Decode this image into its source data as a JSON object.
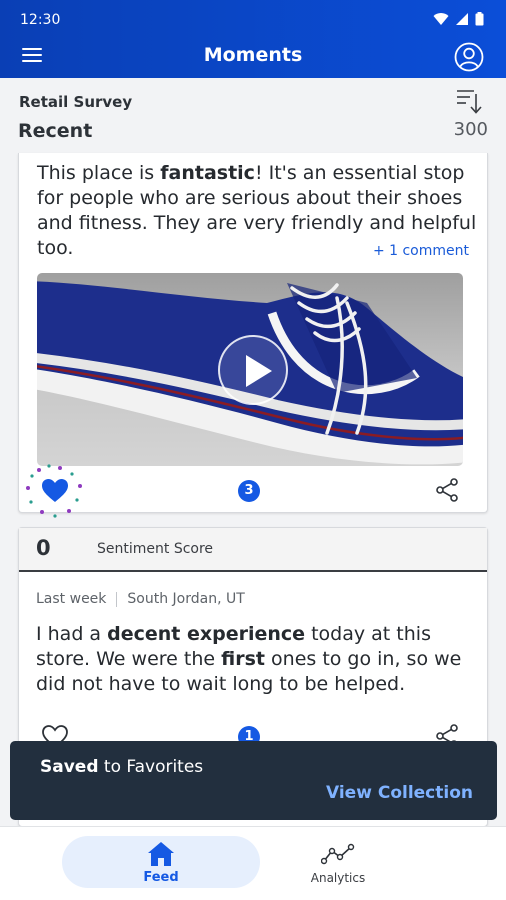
{
  "status_bar": {
    "time": "12:30"
  },
  "app_bar": {
    "title": "Moments"
  },
  "subheader": {
    "survey": "Retail Survey",
    "section": "Recent",
    "count": "300"
  },
  "card1": {
    "text_parts": [
      "This place is ",
      "fantastic",
      "! It's an essential stop for people who are serious about their shoes and fitness. They are very friendly and helpful too."
    ],
    "comment_link": "+ 1 comment",
    "badge_count": "3",
    "liked": true
  },
  "card2": {
    "score": "0",
    "score_label": "Sentiment Score",
    "time": "Last week",
    "location": "South Jordan, UT",
    "text_parts": [
      "I had a ",
      "decent experience",
      " today at this store. We were the ",
      "first",
      " ones to go in, so we did not have to wait long to be helped."
    ],
    "badge_count": "1",
    "liked": false
  },
  "snackbar": {
    "bold": "Saved",
    "rest": " to Favorites",
    "action": "View Collection"
  },
  "bottom_nav": {
    "feed": "Feed",
    "analytics": "Analytics"
  },
  "colors": {
    "primary": "#0b4ed8",
    "accent": "#1559e3",
    "snackbar_bg": "#222f3e",
    "snackbar_action": "#7fb2ff"
  },
  "icons": [
    "menu-icon",
    "account-icon",
    "sort-icon",
    "play-icon",
    "heart-icon",
    "share-icon",
    "home-icon",
    "analytics-icon"
  ]
}
